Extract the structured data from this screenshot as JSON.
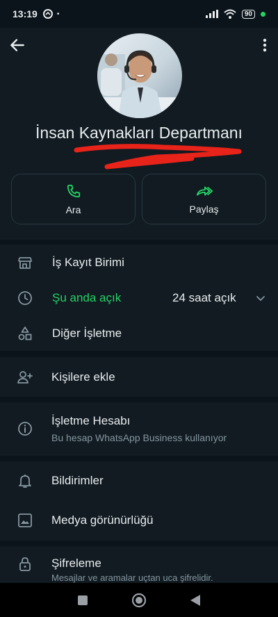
{
  "status_bar": {
    "time": "13:19",
    "dot": "•",
    "battery": "90"
  },
  "profile": {
    "name": "İnsan Kaynakları Departmanı"
  },
  "actions": {
    "call_label": "Ara",
    "share_label": "Paylaş"
  },
  "info": {
    "category": "İş Kayıt Birimi",
    "open_status": "Şu anda açık",
    "hours": "24 saat açık",
    "other": "Diğer İşletme"
  },
  "contacts": {
    "add_label": "Kişilere ekle"
  },
  "business": {
    "title": "İşletme Hesabı",
    "subtitle": "Bu hesap WhatsApp Business kullanıyor"
  },
  "settings": {
    "notifications": "Bildirimler",
    "media_visibility": "Medya görünürlüğü"
  },
  "encryption": {
    "title": "Şifreleme",
    "subtitle": "Mesajlar ve aramalar uçtan uca şifrelidir."
  },
  "colors": {
    "background": "#0b141a",
    "panel": "#111b21",
    "accent_green": "#25d366",
    "text_primary": "#e9edef",
    "text_secondary": "#8696a0"
  }
}
